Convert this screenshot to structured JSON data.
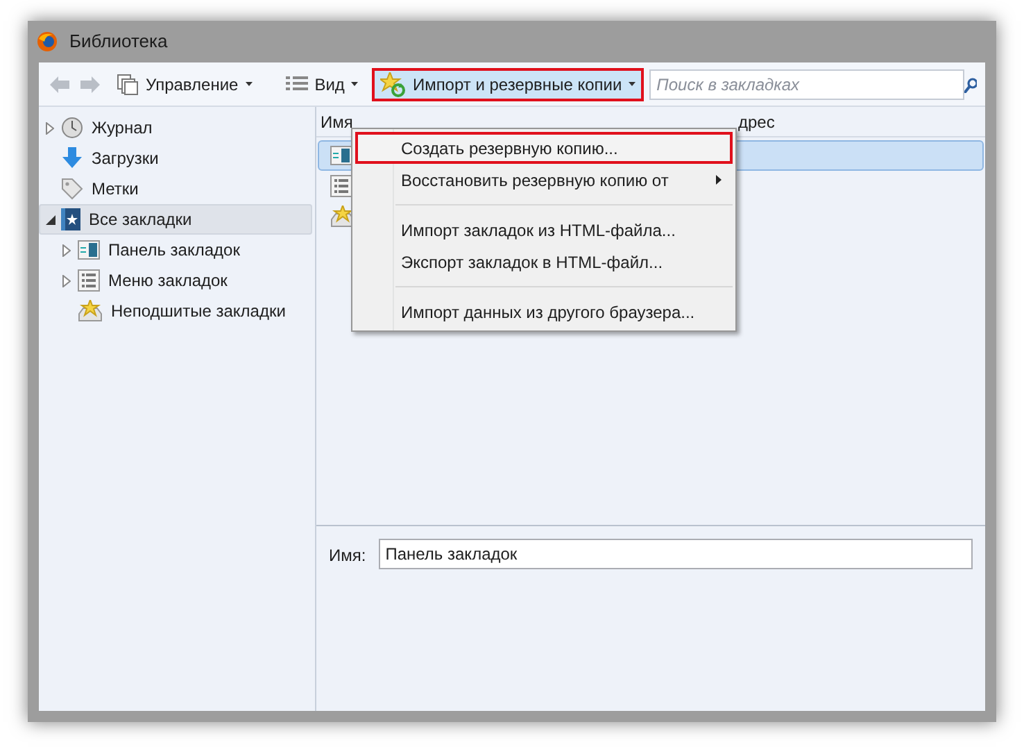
{
  "window": {
    "title": "Библиотека"
  },
  "toolbar": {
    "back": {
      "disabled": true
    },
    "forward": {
      "disabled": true
    },
    "buttons": [
      {
        "kind": "organize",
        "label": "Управление",
        "highlighted": false
      },
      {
        "kind": "view",
        "label": "Вид",
        "highlighted": false
      },
      {
        "kind": "import",
        "label": "Импорт и резервные копии",
        "highlighted": true
      }
    ],
    "search": {
      "placeholder": "Поиск в закладках"
    }
  },
  "sidebar": {
    "items": [
      {
        "kind": "history",
        "label": "Журнал",
        "expanded": false,
        "selected": false
      },
      {
        "kind": "downloads",
        "label": "Загрузки",
        "selected": false
      },
      {
        "kind": "tags",
        "label": "Метки",
        "selected": false
      },
      {
        "kind": "all",
        "label": "Все закладки",
        "expanded": true,
        "selected": true,
        "children": [
          {
            "kind": "toolbar",
            "label": "Панель закладок",
            "expanded": false,
            "selected": false
          },
          {
            "kind": "menu",
            "label": "Меню закладок",
            "expanded": false,
            "selected": false
          },
          {
            "kind": "unsorted",
            "label": "Неподшитые закладки",
            "selected": false
          }
        ]
      }
    ]
  },
  "table": {
    "columns": [
      "Имя",
      "дрес"
    ],
    "rows": [
      {
        "kind": "toolbar",
        "selected": true
      },
      {
        "kind": "menu",
        "selected": false
      },
      {
        "kind": "unsorted",
        "selected": false
      }
    ]
  },
  "details": {
    "name_label": "Имя:",
    "name_value": "Панель закладок"
  },
  "menu": {
    "items": [
      {
        "kind": "item",
        "label": "Создать резервную копию...",
        "highlighted": true,
        "submenu": false
      },
      {
        "kind": "item",
        "label": "Восстановить резервную копию от",
        "highlighted": false,
        "submenu": true
      },
      {
        "kind": "separator"
      },
      {
        "kind": "item",
        "label": "Импорт закладок из HTML-файла...",
        "highlighted": false,
        "submenu": false
      },
      {
        "kind": "item",
        "label": "Экспорт закладок в HTML-файл...",
        "highlighted": false,
        "submenu": false
      },
      {
        "kind": "separator"
      },
      {
        "kind": "item",
        "label": "Импорт данных из другого браузера...",
        "highlighted": false,
        "submenu": false
      }
    ]
  }
}
